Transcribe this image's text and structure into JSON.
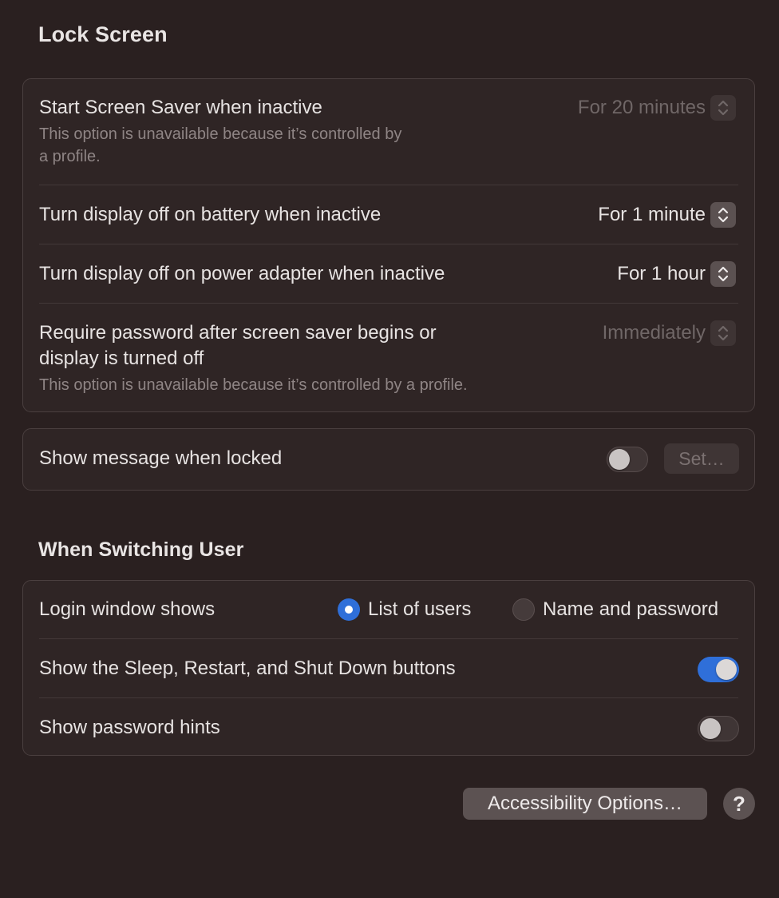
{
  "lock_screen": {
    "title": "Lock Screen",
    "rows": [
      {
        "label": "Start Screen Saver when inactive",
        "note_line1": "This option is unavailable because it’s controlled by",
        "note_line2": "a profile.",
        "value": "For 20 minutes",
        "enabled": false
      },
      {
        "label": "Turn display off on battery when inactive",
        "value": "For 1 minute",
        "enabled": true
      },
      {
        "label": "Turn display off on power adapter when inactive",
        "value": "For 1 hour",
        "enabled": true
      },
      {
        "label_line1": "Require password after screen saver begins or",
        "label_line2": "display is turned off",
        "note": "This option is unavailable because it’s controlled by a profile.",
        "value": "Immediately",
        "enabled": false
      }
    ],
    "message": {
      "label": "Show message when locked",
      "toggle_on": false,
      "set_button": "Set…"
    }
  },
  "switching_user": {
    "title": "When Switching User",
    "login_window": {
      "label": "Login window shows",
      "options": [
        {
          "label": "List of users",
          "selected": true
        },
        {
          "label": "Name and password",
          "selected": false
        }
      ]
    },
    "sleep_buttons": {
      "label": "Show the Sleep, Restart, and Shut Down buttons",
      "toggle_on": true
    },
    "password_hints": {
      "label": "Show password hints",
      "toggle_on": false
    }
  },
  "footer": {
    "accessibility_button": "Accessibility Options…",
    "help_button": "?"
  },
  "colors": {
    "background": "#2a2020",
    "accent": "#2f6fd9"
  }
}
